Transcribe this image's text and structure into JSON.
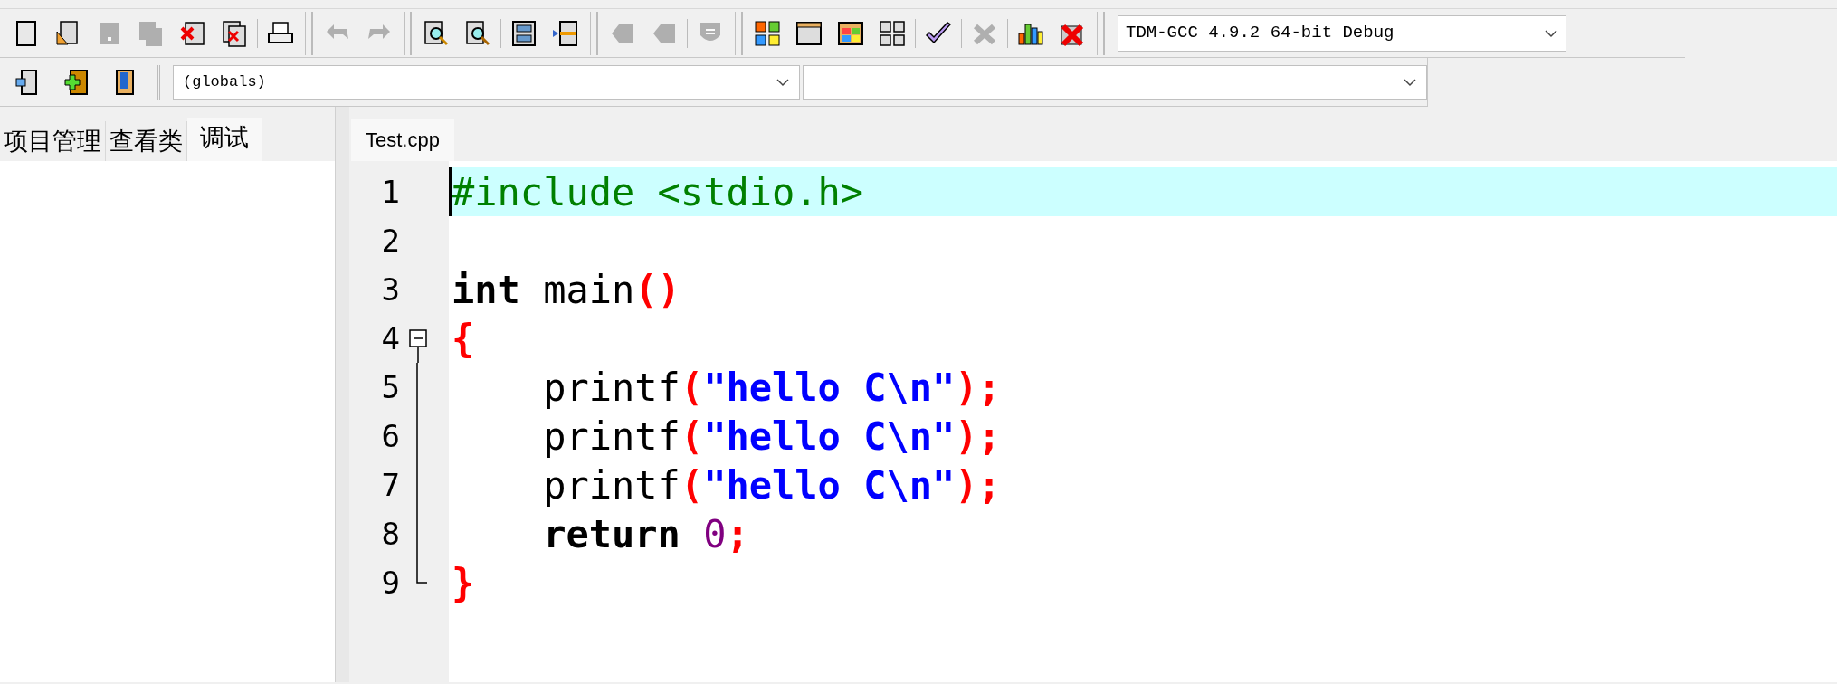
{
  "toolbar_main": [
    [
      [
        {
          "kind": "new",
          "disabled": false
        },
        {
          "kind": "open",
          "disabled": false
        },
        {
          "kind": "save",
          "disabled": true
        },
        {
          "kind": "save-all",
          "disabled": true
        },
        {
          "kind": "close",
          "disabled": false
        },
        {
          "kind": "close-all",
          "disabled": false
        }
      ],
      [
        {
          "kind": "print",
          "disabled": false
        }
      ]
    ],
    [
      [
        {
          "kind": "undo",
          "disabled": true
        },
        {
          "kind": "redo",
          "disabled": true
        }
      ]
    ],
    [
      [
        {
          "kind": "find",
          "disabled": false
        },
        {
          "kind": "replace",
          "disabled": false
        }
      ],
      [
        {
          "kind": "windows",
          "disabled": false
        },
        {
          "kind": "goto",
          "disabled": false
        }
      ]
    ],
    [
      [
        {
          "kind": "arrow-left",
          "disabled": true
        },
        {
          "kind": "arrow-right",
          "disabled": true
        }
      ],
      [
        {
          "kind": "shield",
          "disabled": true
        }
      ]
    ],
    [
      [
        {
          "kind": "grid-color",
          "disabled": false
        },
        {
          "kind": "window",
          "disabled": false
        },
        {
          "kind": "tiles",
          "disabled": false
        },
        {
          "kind": "grid",
          "disabled": false
        }
      ],
      [
        {
          "kind": "check",
          "disabled": false
        }
      ],
      [
        {
          "kind": "cross",
          "disabled": true
        }
      ],
      [
        {
          "kind": "chart",
          "disabled": false
        },
        {
          "kind": "delete",
          "disabled": false
        }
      ]
    ]
  ],
  "compiler_select": {
    "value": "TDM-GCC 4.9.2 64-bit Debug"
  },
  "toolbar_class": [
    {
      "kind": "class-insert",
      "disabled": false
    },
    {
      "kind": "class-add",
      "disabled": false
    },
    {
      "kind": "book",
      "disabled": false
    }
  ],
  "scope_select": {
    "value": "(globals)"
  },
  "left_tabs": [
    {
      "label": "项目管理",
      "selected": false
    },
    {
      "label": "查看类",
      "selected": false
    },
    {
      "label": "调试",
      "selected": true
    }
  ],
  "editor_tabs": [
    {
      "label": "Test.cpp",
      "selected": true
    }
  ],
  "code": [
    {
      "number": "1",
      "current": true,
      "tokens": [
        {
          "text": "#include <stdio.h>",
          "kind": "pre"
        }
      ]
    },
    {
      "number": "2",
      "current": false
    },
    {
      "number": "3",
      "current": false,
      "tokens": [
        {
          "text": "int",
          "kind": "keyword"
        },
        {
          "text": " main",
          "kind": "plain"
        },
        {
          "text": "()",
          "kind": "symbol"
        }
      ]
    },
    {
      "number": "4",
      "current": false,
      "expanded": true,
      "tokens": [
        {
          "text": "{",
          "kind": "symbol"
        }
      ],
      "children": [
        {
          "number": "5",
          "current": false,
          "tokens": [
            {
              "text": "    printf",
              "kind": "plain"
            },
            {
              "text": "(",
              "kind": "symbol"
            },
            {
              "text": "\"hello C\\n\"",
              "kind": "string"
            },
            {
              "text": ");",
              "kind": "symbol"
            }
          ]
        },
        {
          "number": "6",
          "current": false,
          "tokens": [
            {
              "text": "    printf",
              "kind": "plain"
            },
            {
              "text": "(",
              "kind": "symbol"
            },
            {
              "text": "\"hello C\\n\"",
              "kind": "string"
            },
            {
              "text": ");",
              "kind": "symbol"
            }
          ]
        },
        {
          "number": "7",
          "current": false,
          "tokens": [
            {
              "text": "    printf",
              "kind": "plain"
            },
            {
              "text": "(",
              "kind": "symbol"
            },
            {
              "text": "\"hello C\\n\"",
              "kind": "string"
            },
            {
              "text": ");",
              "kind": "symbol"
            }
          ]
        },
        {
          "number": "8",
          "current": false,
          "tokens": [
            {
              "text": "    return",
              "kind": "keyword"
            },
            {
              "text": " 0",
              "kind": "number"
            },
            {
              "text": ";",
              "kind": "symbol"
            }
          ]
        },
        {
          "number": "9",
          "current": false,
          "tokens": [
            {
              "text": "}",
              "kind": "symbol"
            }
          ]
        }
      ]
    }
  ]
}
